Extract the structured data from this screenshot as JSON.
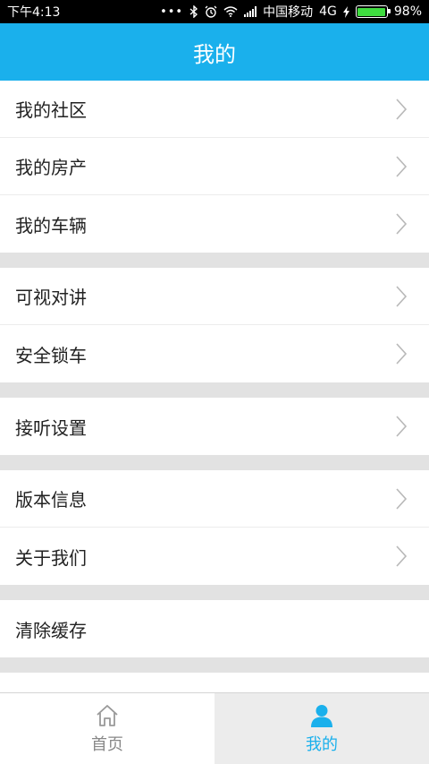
{
  "status_bar": {
    "time": "下午4:13",
    "carrier": "中国移动",
    "network": "4G",
    "battery": "98%",
    "battery_level": 0.98,
    "icons": [
      "more-dots-icon",
      "bluetooth-icon",
      "alarm-icon",
      "wifi-icon",
      "signal-icon",
      "charging-icon",
      "battery-icon"
    ]
  },
  "header": {
    "title": "我的"
  },
  "menu": {
    "groups": [
      {
        "items": [
          {
            "label": "我的社区"
          },
          {
            "label": "我的房产"
          },
          {
            "label": "我的车辆"
          }
        ]
      },
      {
        "items": [
          {
            "label": "可视对讲"
          },
          {
            "label": "安全锁车"
          }
        ]
      },
      {
        "items": [
          {
            "label": "接听设置"
          }
        ]
      },
      {
        "items": [
          {
            "label": "版本信息"
          },
          {
            "label": "关于我们"
          }
        ]
      },
      {
        "items": [
          {
            "label": "清除缓存"
          }
        ]
      }
    ]
  },
  "tabbar": {
    "tabs": [
      {
        "label": "首页",
        "icon": "home-icon",
        "active": false
      },
      {
        "label": "我的",
        "icon": "user-icon",
        "active": true
      }
    ]
  },
  "colors": {
    "accent": "#1ab0ec",
    "background": "#e2e2e2",
    "text": "#222222"
  }
}
